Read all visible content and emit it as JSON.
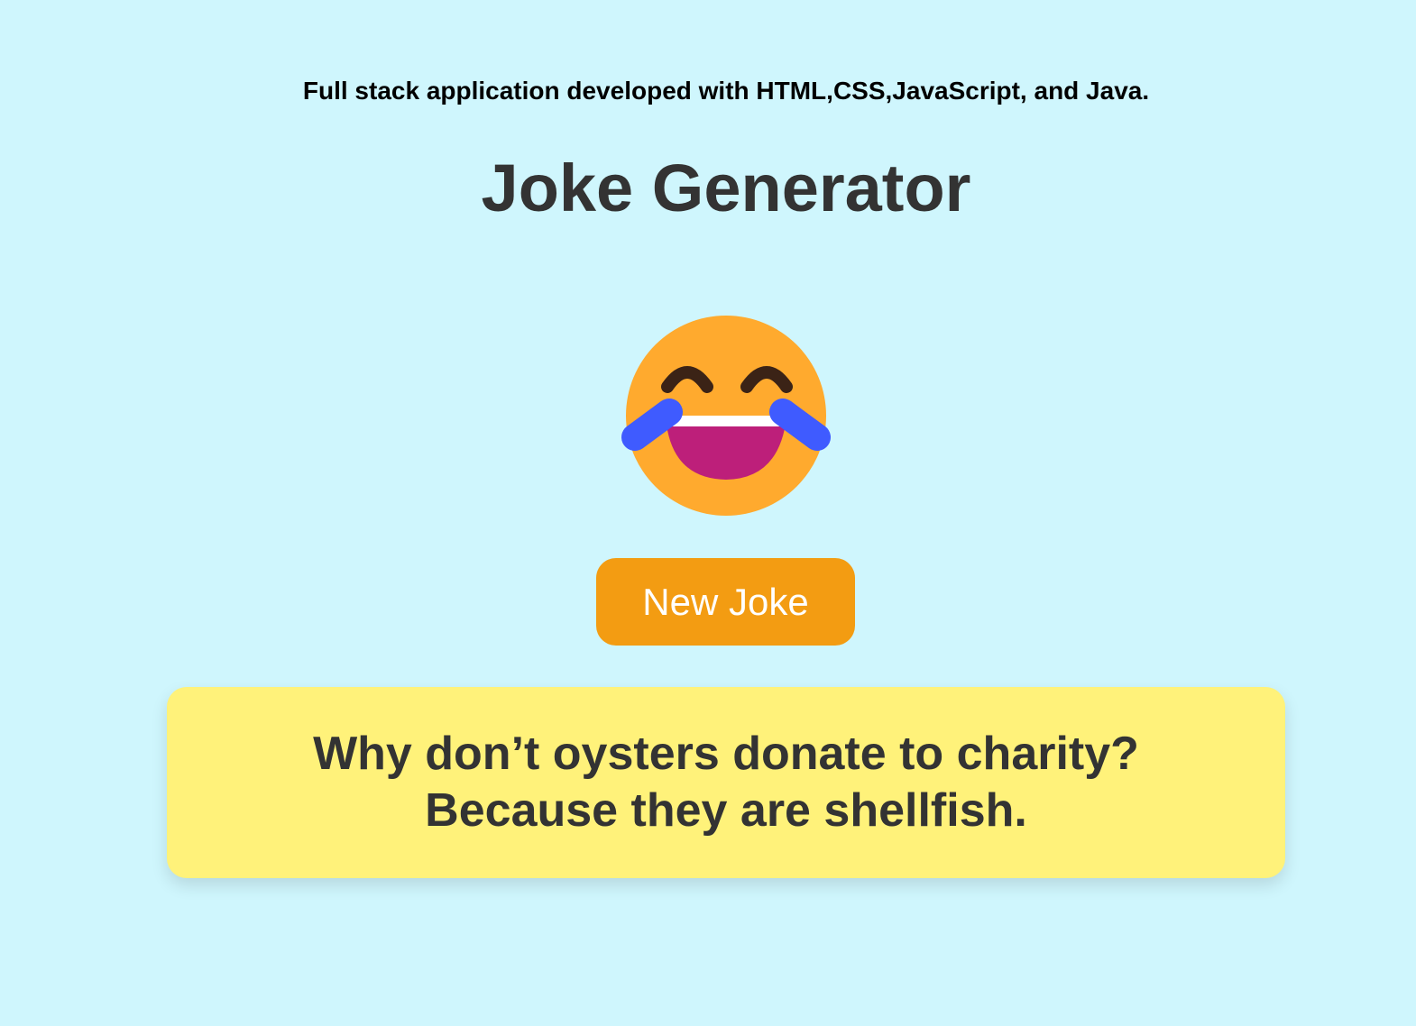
{
  "header": {
    "subtitle": "Full stack application developed with HTML,CSS,JavaScript, and Java.",
    "title": "Joke Generator"
  },
  "emoji": {
    "icon": "face-with-tears-of-joy-icon"
  },
  "actions": {
    "new_joke_label": "New Joke"
  },
  "joke": {
    "setup": "Why don’t oysters donate to charity?",
    "punchline": "Because they are shellfish."
  },
  "colors": {
    "background": "#cff6fd",
    "button": "#f39c12",
    "joke_box": "#fff27a",
    "title_text": "#333333"
  }
}
